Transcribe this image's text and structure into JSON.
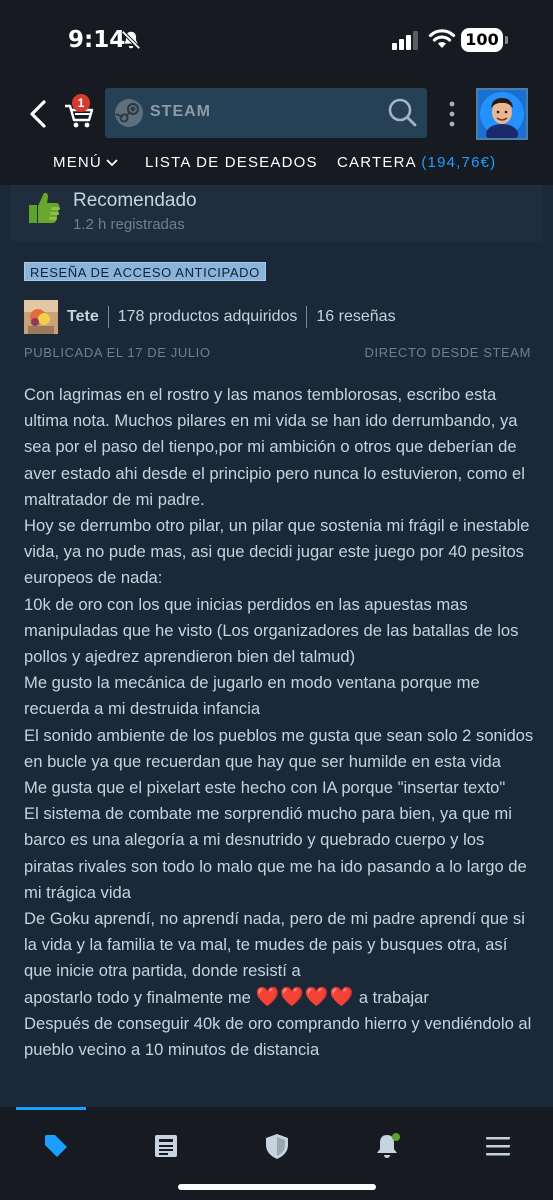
{
  "status_bar": {
    "time": "9:14",
    "battery": "100"
  },
  "header": {
    "cart_count": "1",
    "search_logo_text": "STEAM",
    "nav": {
      "menu": "MENÚ",
      "wishlist": "LISTA DE DESEADOS",
      "wallet": "CARTERA",
      "balance": "(194,76€)"
    }
  },
  "review": {
    "verdict": "Recomendado",
    "hours": "1.2 h registradas",
    "badge": "RESEÑA DE ACCESO ANTICIPADO",
    "author": {
      "name": "Tete",
      "products": "178 productos adquiridos",
      "reviews": "16 reseñas"
    },
    "posted": "PUBLICADA EL 17 DE JULIO",
    "source": "DIRECTO DESDE STEAM",
    "paragraphs": [
      "Con lagrimas en el rostro y las manos temblorosas, escribo esta ultima nota. Muchos pilares en mi vida se han ido derrumbando, ya sea por el paso del tienpo,por mi ambición o otros que deberían de aver estado ahi desde el principio pero nunca lo estuvieron, como el maltratador de mi padre.",
      "Hoy se derrumbo otro pilar, un pilar que sostenia mi frágil e inestable vida, ya no pude mas, asi que decidi jugar este juego por 40 pesitos europeos de nada:",
      "10k de oro con los que inicias perdidos en las apuestas mas manipuladas que he visto (Los organizadores de las batallas de los pollos y ajedrez aprendieron bien del talmud)",
      "Me gusto la mecánica de jugarlo en modo ventana porque me recuerda a mi destruida infancia",
      "El sonido ambiente de los pueblos me gusta que sean solo 2 sonidos en bucle ya que recuerdan que hay que ser humilde en esta vida",
      "Me gusta que el pixelart este hecho con IA porque \"insertar texto\"",
      "El sistema de combate me sorprendió mucho para bien, ya que mi barco es una alegoría a mi desnutrido y quebrado cuerpo y los piratas rivales son todo lo malo que me ha ido pasando a lo largo de mi trágica vida",
      "De Goku aprendí, no aprendí nada, pero de mi padre aprendí que si la vida y la familia te va mal, te mudes de pais y busques otra, así que inicie otra partida, donde resistí a"
    ],
    "heart_line_before": "apostarlo todo y finalmente me",
    "hearts": "❤️❤️❤️❤️",
    "heart_line_after": "a trabajar",
    "last_paragraph": "Después de conseguir 40k de oro comprando hierro y vendiéndolo al pueblo vecino a 10 minutos de distancia"
  }
}
